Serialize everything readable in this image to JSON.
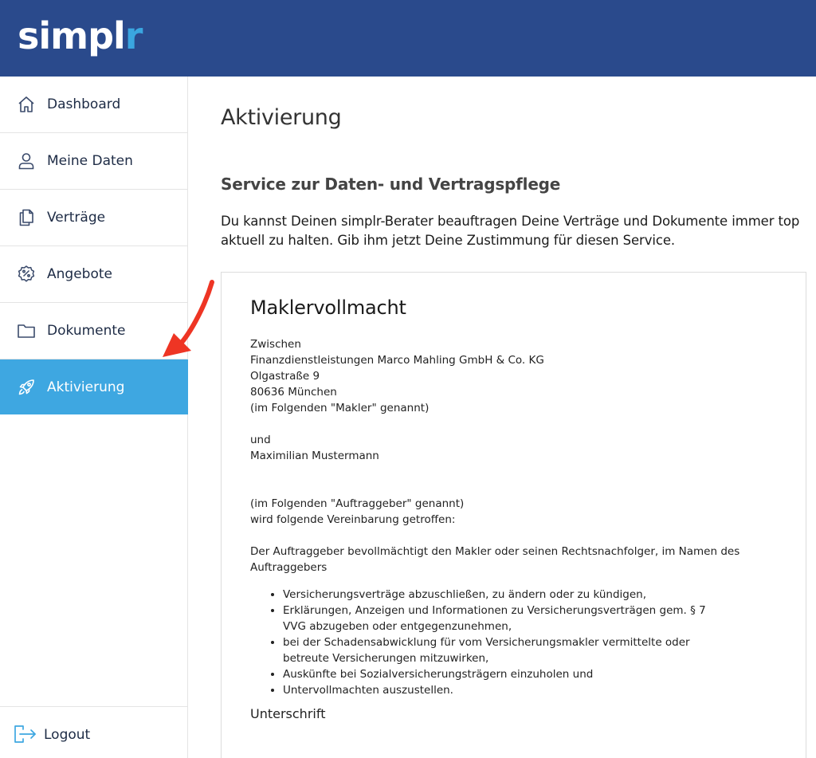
{
  "brand": {
    "logo_main": "simpl",
    "logo_accent": "r",
    "accent_color": "#3ea7e1",
    "header_color": "#2a4a8c"
  },
  "sidebar": {
    "items": [
      {
        "label": "Dashboard",
        "icon": "home-icon"
      },
      {
        "label": "Meine Daten",
        "icon": "user-icon"
      },
      {
        "label": "Verträge",
        "icon": "documents-icon"
      },
      {
        "label": "Angebote",
        "icon": "percent-badge-icon"
      },
      {
        "label": "Dokumente",
        "icon": "folder-icon"
      },
      {
        "label": "Aktivierung",
        "icon": "rocket-icon",
        "active": true
      }
    ],
    "logout": {
      "label": "Logout",
      "icon": "logout-icon"
    }
  },
  "main": {
    "title": "Aktivierung",
    "section_title": "Service zur Daten- und Vertragspflege",
    "intro": "Du kannst Deinen simplr-Berater beauftragen Deine Verträge und Dokumente immer top aktuell zu halten. Gib ihm jetzt Deine Zustimmung für diesen Service.",
    "card": {
      "title": "Maklervollmacht",
      "between": "Zwischen",
      "company": "Finanzdienstleistungen Marco Mahling GmbH & Co. KG",
      "street": "Olgastraße 9",
      "city": "80636 München",
      "makler_note": "(im Folgenden \"Makler\" genannt)",
      "and": "und",
      "client": "Maximilian Mustermann",
      "client_note": "(im Folgenden \"Auftraggeber\" genannt)",
      "agreement": "wird folgende Vereinbarung getroffen:",
      "authorization": "Der Auftraggeber bevollmächtigt den Makler oder seinen Rechtsnachfolger, im Namen des Auftraggebers",
      "list": [
        "Versicherungsverträge abzuschließen, zu ändern oder zu kündigen,",
        "Erklärungen, Anzeigen und Informationen zu Versicherungsverträgen gem. § 7 VVG abzugeben oder entgegenzunehmen,",
        "bei der Schadensabwicklung für vom Versicherungsmakler vermittelte oder betreute Versicherungen mitzuwirken,",
        "Auskünfte bei Sozialversicherungsträgern einzuholen und",
        "Untervollmachten auszustellen."
      ],
      "signature_label": "Unterschrift"
    }
  }
}
